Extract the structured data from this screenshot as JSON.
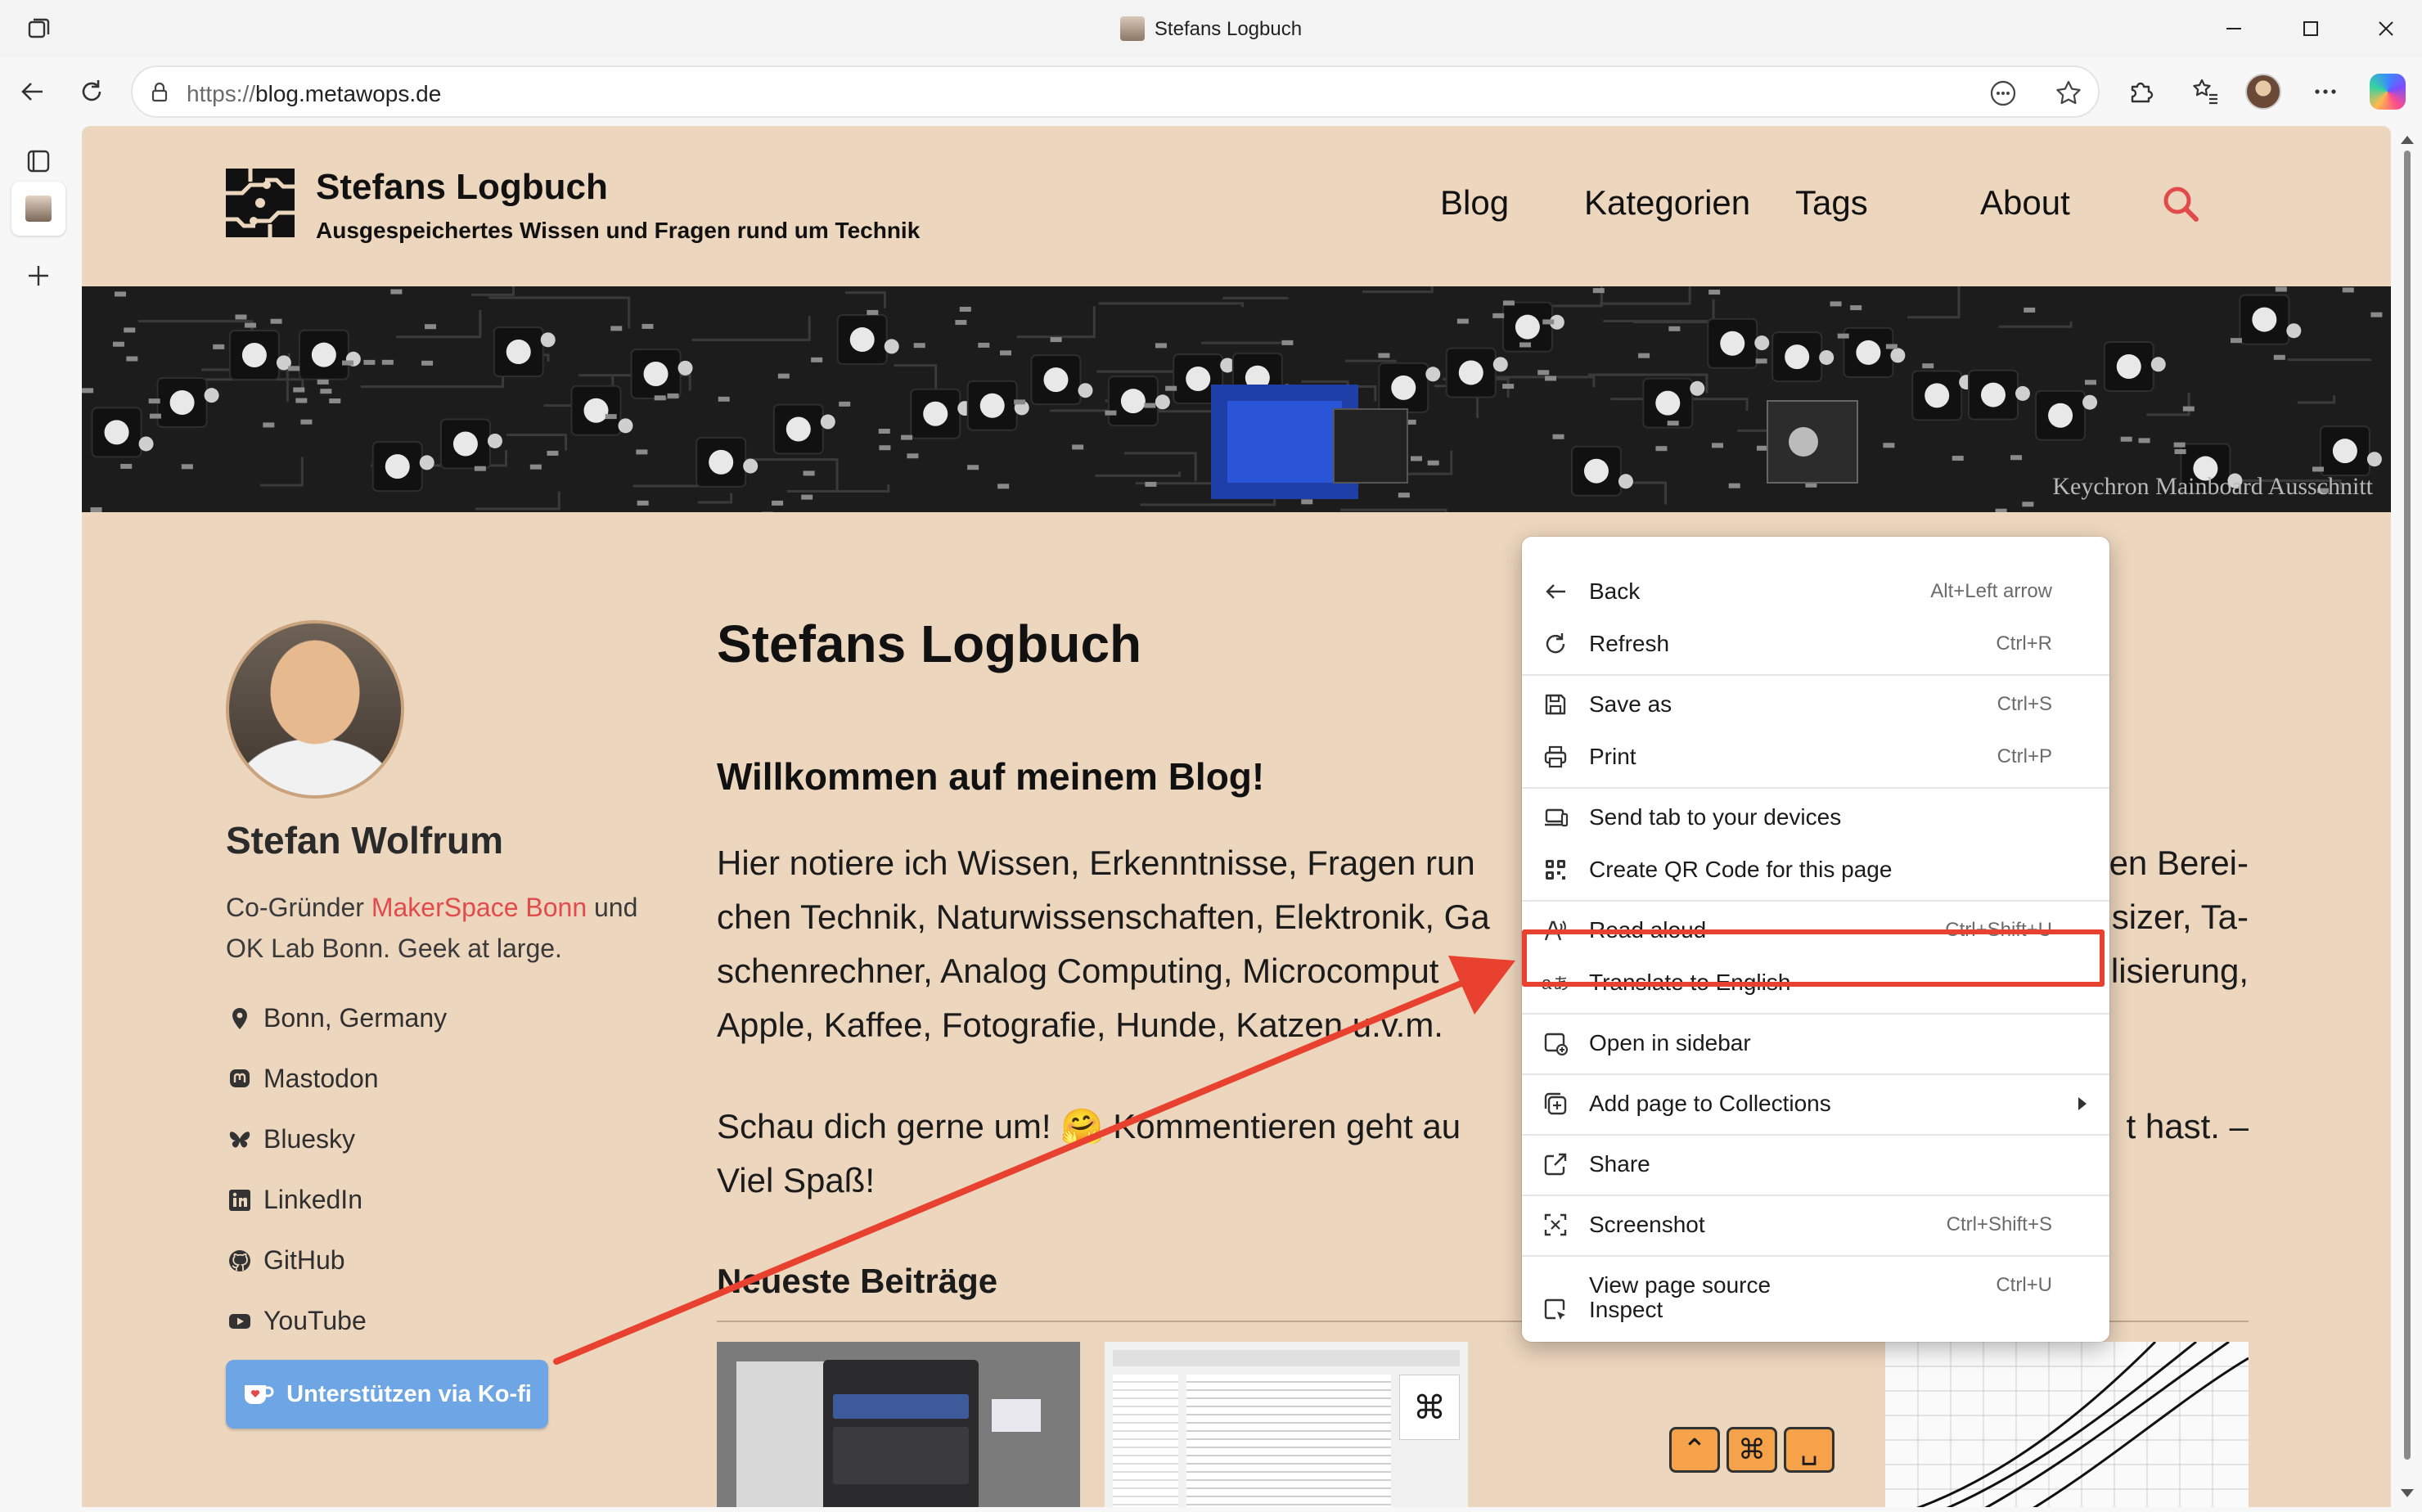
{
  "window": {
    "title": "Stefans Logbuch"
  },
  "address": {
    "scheme": "https://",
    "host": "blog.metawops.de"
  },
  "site": {
    "title": "Stefans Logbuch",
    "tagline": "Ausgespeichertes Wissen und Fragen rund um Technik",
    "nav": [
      "Blog",
      "Kategorien",
      "Tags",
      "About"
    ],
    "hero_caption": "Keychron Mainboard Ausschnitt"
  },
  "sidebar": {
    "author": "Stefan Wolfrum",
    "bio_prefix": "Co-Gründer ",
    "bio_link": "MakerSpace Bonn",
    "bio_suffix": " und OK Lab Bonn. Geek at large.",
    "links": [
      {
        "label": "Bonn, Germany",
        "icon": "location-pin-icon"
      },
      {
        "label": "Mastodon",
        "icon": "mastodon-icon"
      },
      {
        "label": "Bluesky",
        "icon": "bluesky-butterfly-icon"
      },
      {
        "label": "LinkedIn",
        "icon": "linkedin-icon"
      },
      {
        "label": "GitHub",
        "icon": "github-icon"
      },
      {
        "label": "YouTube",
        "icon": "youtube-icon"
      }
    ],
    "kofi_label": "Unterstützen via Ko-fi"
  },
  "main": {
    "title": "Stefans Logbuch",
    "welcome": "Willkommen auf meinem Blog!",
    "intro": "Hier notiere ich Wissen, Erkenntnisse, Fragen run",
    "intro_line1_end": "en Berei-",
    "intro_line2": "chen Technik, Naturwissenschaften, Elektronik, Ga",
    "intro_line2_end": "sizer, Ta-",
    "intro_line3": "schenrechner, Analog Computing, Microcomput",
    "intro_line3_end": "lisierung,",
    "intro_line4": "Apple, Kaffee, Fotografie, Hunde, Katzen u.v.m.",
    "outro_line1": "Schau dich gerne um! 🤗 Kommentieren geht au",
    "outro_line1_end": "t hast. –",
    "outro_line2": "Viel Spaß!",
    "latest_heading": "Neueste Beiträge"
  },
  "context_menu": {
    "items": [
      {
        "label": "Back",
        "shortcut": "Alt+Left arrow",
        "icon": "back-arrow-icon"
      },
      {
        "label": "Refresh",
        "shortcut": "Ctrl+R",
        "icon": "refresh-icon"
      },
      {
        "label": "Save as",
        "shortcut": "Ctrl+S",
        "icon": "save-icon"
      },
      {
        "label": "Print",
        "shortcut": "Ctrl+P",
        "icon": "printer-icon"
      },
      {
        "label": "Send tab to your devices",
        "shortcut": "",
        "icon": "send-device-icon"
      },
      {
        "label": "Create QR Code for this page",
        "shortcut": "",
        "icon": "qr-code-icon"
      },
      {
        "label": "Read aloud",
        "shortcut": "Ctrl+Shift+U",
        "icon": "read-aloud-icon"
      },
      {
        "label": "Translate to English",
        "shortcut": "",
        "icon": "translate-icon"
      },
      {
        "label": "Open in sidebar",
        "shortcut": "",
        "icon": "sidebar-icon"
      },
      {
        "label": "Add page to Collections",
        "shortcut": "",
        "icon": "collections-icon"
      },
      {
        "label": "Share",
        "shortcut": "",
        "icon": "share-icon"
      },
      {
        "label": "Screenshot",
        "shortcut": "Ctrl+Shift+S",
        "icon": "screenshot-icon"
      },
      {
        "label": "View page source",
        "shortcut": "Ctrl+U",
        "icon": ""
      },
      {
        "label": "Inspect",
        "shortcut": "",
        "icon": "inspect-icon"
      }
    ]
  },
  "colors": {
    "page_bg": "#ecd6bd",
    "accent_link": "#e24b4b",
    "highlight": "#e8412f",
    "kofi": "#6ea5e4"
  }
}
